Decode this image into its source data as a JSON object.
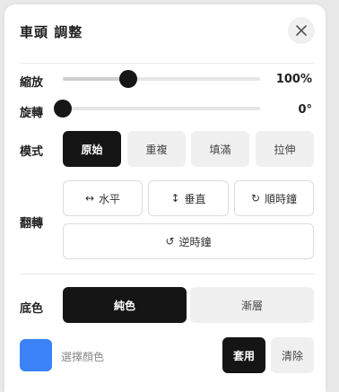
{
  "header": {
    "title": "車頭 調整",
    "close_icon": "close-icon"
  },
  "zoom": {
    "label": "縮放",
    "value_text": "100%",
    "value": 100,
    "position": 0.33
  },
  "rotate": {
    "label": "旋轉",
    "value_text": "0°",
    "value": 0,
    "position": 0.0
  },
  "mode": {
    "label": "模式",
    "options": [
      "原始",
      "重複",
      "填滿",
      "拉伸"
    ],
    "selected": "原始"
  },
  "flip": {
    "label": "翻轉",
    "horizontal": {
      "icon": "↔",
      "label": "水平"
    },
    "vertical": {
      "icon": "↕",
      "label": "垂直"
    },
    "clockwise": {
      "icon": "↻",
      "label": "順時鐘"
    },
    "counterclockwise": {
      "icon": "↺",
      "label": "逆時鐘"
    }
  },
  "background": {
    "label": "底色",
    "options": [
      "純色",
      "漸層"
    ],
    "selected": "純色"
  },
  "color": {
    "swatch": "#3b82f6",
    "label": "選擇顏色",
    "apply_label": "套用",
    "clear_label": "清除"
  }
}
